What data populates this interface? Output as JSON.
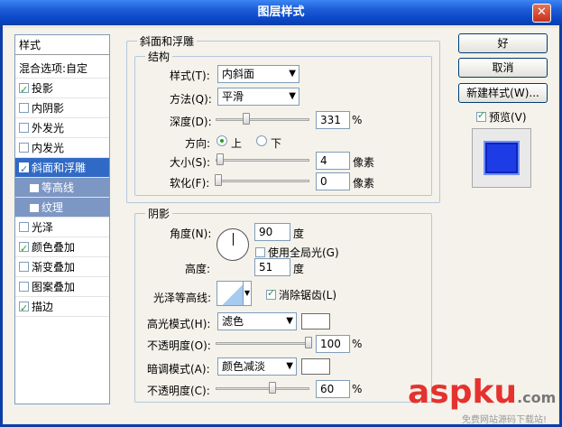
{
  "window": {
    "title": "图层样式",
    "close_glyph": "✕"
  },
  "left_panel": {
    "header": "样式",
    "blend_options": "混合选项:自定",
    "items": [
      {
        "label": "投影",
        "checked": true
      },
      {
        "label": "内阴影",
        "checked": false
      },
      {
        "label": "外发光",
        "checked": false
      },
      {
        "label": "内发光",
        "checked": false
      },
      {
        "label": "斜面和浮雕",
        "checked": true,
        "selected": true
      },
      {
        "label": "等高线",
        "sub": true
      },
      {
        "label": "纹理",
        "sub": true
      },
      {
        "label": "光泽",
        "checked": false
      },
      {
        "label": "颜色叠加",
        "checked": true
      },
      {
        "label": "渐变叠加",
        "checked": false
      },
      {
        "label": "图案叠加",
        "checked": false
      },
      {
        "label": "描边",
        "checked": true
      }
    ]
  },
  "bevel": {
    "section_title": "斜面和浮雕",
    "structure_title": "结构",
    "style": {
      "label": "样式(T):",
      "value": "内斜面"
    },
    "technique": {
      "label": "方法(Q):",
      "value": "平滑"
    },
    "depth": {
      "label": "深度(D):",
      "value": "331",
      "unit": "%",
      "slider_pos": 0.2
    },
    "direction": {
      "label": "方向:",
      "up": "上",
      "down": "下",
      "selected": "up"
    },
    "size": {
      "label": "大小(S):",
      "value": "4",
      "unit": "像素",
      "slider_pos": 0.02
    },
    "soften": {
      "label": "软化(F):",
      "value": "0",
      "unit": "像素",
      "slider_pos": 0.0
    }
  },
  "shading": {
    "title": "阴影",
    "angle": {
      "label": "角度(N):",
      "value": "90",
      "unit": "度"
    },
    "global_light": {
      "label": "使用全局光(G)",
      "checked": false
    },
    "altitude": {
      "label": "高度:",
      "value": "51",
      "unit": "度"
    },
    "gloss_contour": {
      "label": "光泽等高线:"
    },
    "anti_aliased": {
      "label": "消除锯齿(L)",
      "checked": true
    },
    "highlight_mode": {
      "label": "高光模式(H):",
      "value": "滤色",
      "color": "#ffffff"
    },
    "highlight_opacity": {
      "label": "不透明度(O):",
      "value": "100",
      "unit": "%",
      "slider_pos": 1.0
    },
    "shadow_mode": {
      "label": "暗调模式(A):",
      "value": "颜色减淡",
      "color": "#ffffff"
    },
    "shadow_opacity": {
      "label": "不透明度(C):",
      "value": "60",
      "unit": "%",
      "slider_pos": 0.6
    }
  },
  "right_buttons": {
    "ok": "好",
    "cancel": "取消",
    "new_style": "新建样式(W)...",
    "preview": {
      "label": "预览(V)",
      "checked": true
    },
    "preview_color": "#1e3ce6"
  },
  "watermark": {
    "text": "aspku",
    "suffix": ".com",
    "sub": "免费网站源码下载站!"
  }
}
